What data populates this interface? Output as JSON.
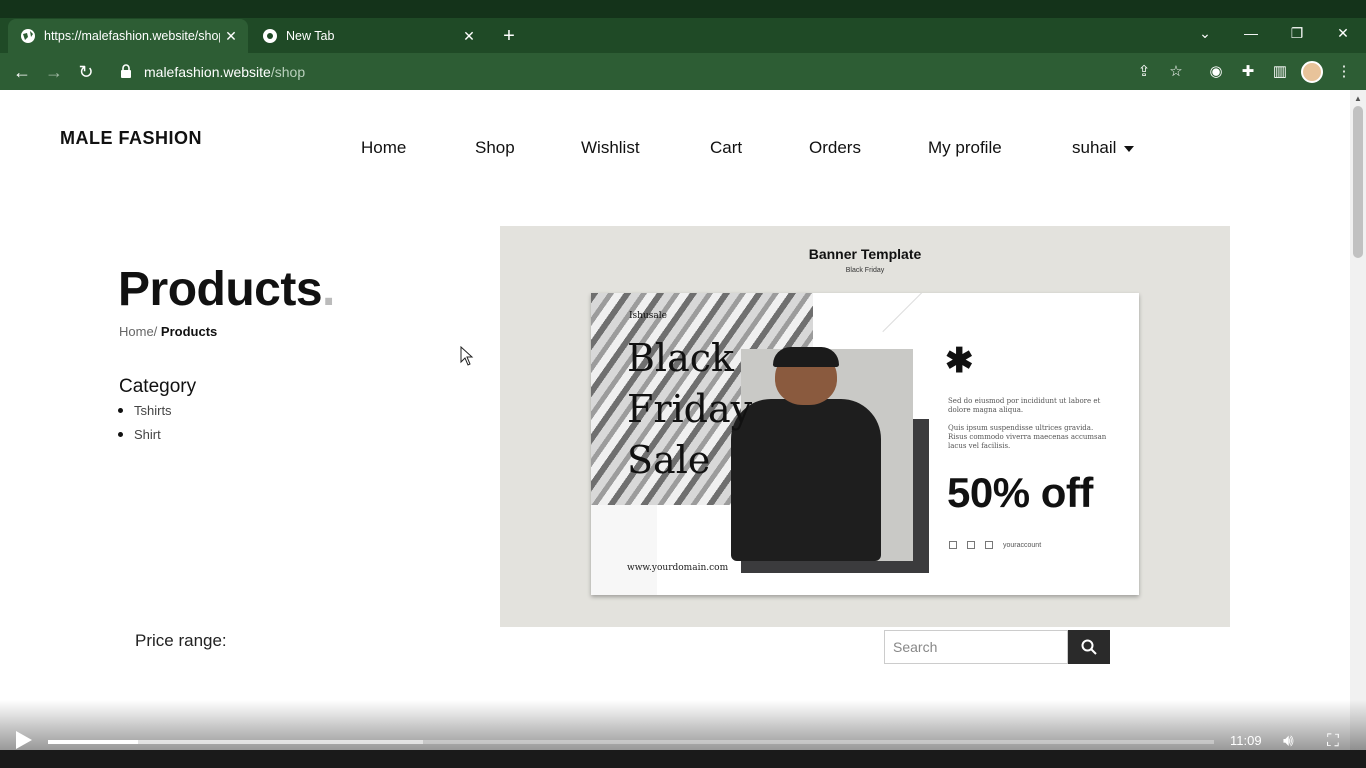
{
  "browser": {
    "tabs": [
      {
        "title": "https://malefashion.website/shop",
        "active": true
      },
      {
        "title": "New Tab",
        "active": false
      }
    ],
    "new_tab_label": "+",
    "address": {
      "domain": "malefashion.website",
      "path": "/shop"
    },
    "window_controls": {
      "dropdown": "⌄",
      "minimize": "—",
      "restore": "❐",
      "close": "✕"
    },
    "nav": {
      "back": "←",
      "forward": "→",
      "reload": "↻"
    },
    "toolbar_icons": [
      "share-icon",
      "star-icon",
      "vpn-icon",
      "extensions-icon",
      "sidepanel-icon",
      "profile-avatar",
      "menu-icon"
    ]
  },
  "site": {
    "logo": "MALE FASHION",
    "nav": [
      "Home",
      "Shop",
      "Wishlist",
      "Cart",
      "Orders",
      "My profile"
    ],
    "user": "suhail"
  },
  "page": {
    "title": "Products",
    "title_dot": ".",
    "breadcrumb": {
      "home": "Home/",
      "current": "Products"
    },
    "category_heading": "Category",
    "categories": [
      "Tshirts",
      "Shirt"
    ],
    "price_range_label": "Price range:",
    "search_placeholder": "Search"
  },
  "banner": {
    "title": "Banner Template",
    "subtitle": "Black Friday",
    "tag": "Ishusale",
    "headline": [
      "Black",
      "Friday",
      "Sale"
    ],
    "domain": "www.yourdomain.com",
    "lorem1": "Sed do eiusmod por incididunt ut labore et dolore magna aliqua.",
    "lorem2": "Quis ipsum suspendisse ultrices gravida. Risus commodo viverra maecenas accumsan lacus vel facilisis.",
    "offer": "50% off",
    "social_handle": "youraccount"
  },
  "video": {
    "time": "11:09",
    "progress": 0.077,
    "buffered": 0.322
  }
}
